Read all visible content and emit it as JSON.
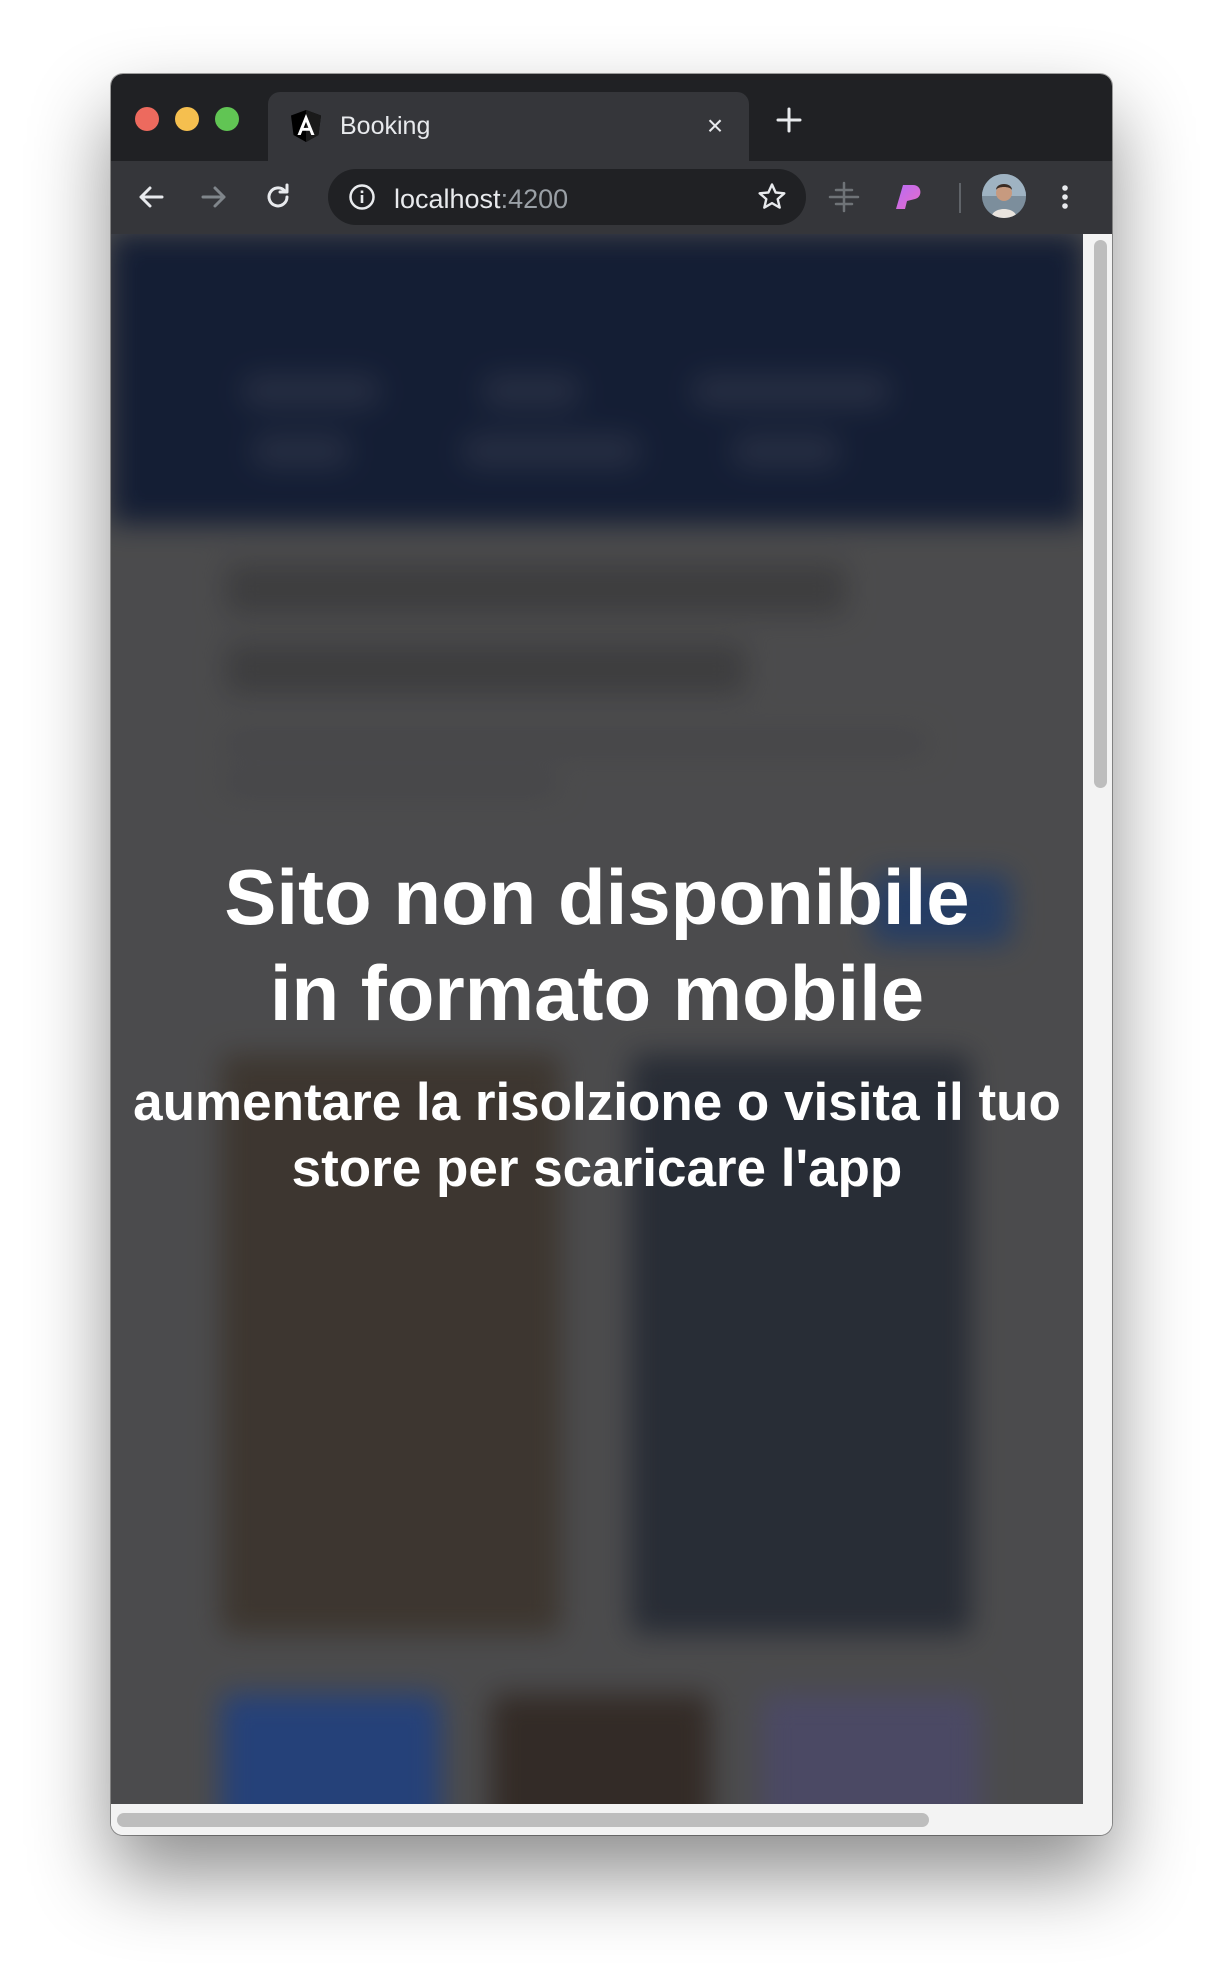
{
  "window": {
    "traffic_lights": [
      "close",
      "minimize",
      "zoom"
    ]
  },
  "tab": {
    "title": "Booking",
    "favicon": "angular-icon",
    "close_label": "×"
  },
  "toolbar": {
    "url_host": "localhost",
    "url_port": ":4200",
    "icons": [
      "back-arrow-icon",
      "forward-arrow-icon",
      "reload-icon",
      "info-icon",
      "bookmark-star-icon",
      "extension-icon",
      "extension-icon",
      "profile-avatar",
      "more-vert-icon"
    ]
  },
  "page": {
    "overlay_title_line1": "Sito non disponibile",
    "overlay_title_line2": "in formato mobile",
    "overlay_sub_line1": "aumentare la risolzione o visita il tuo",
    "overlay_sub_line2": "store per scaricare l'app"
  },
  "colors": {
    "chrome_dark": "#202124",
    "chrome_toolbar": "#35363a",
    "hero_navy": "#03102e",
    "overlay_gray": "#4d4d4f"
  }
}
